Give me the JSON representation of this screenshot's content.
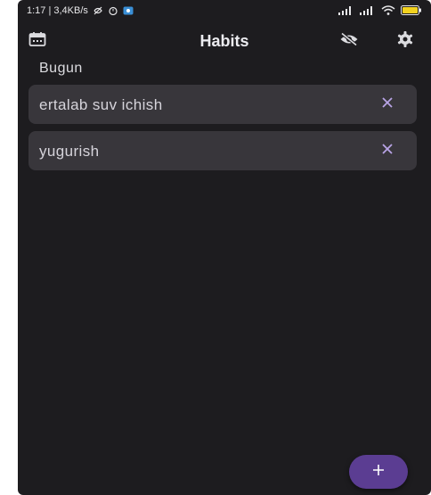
{
  "status_bar": {
    "time_speed": "1:17 | 3,4KB/s",
    "icons": [
      "hidden-sync-icon",
      "alarm-icon",
      "app-notification-icon"
    ],
    "right_icons": [
      "signal-icon",
      "signal-icon",
      "wifi-icon",
      "battery-icon"
    ]
  },
  "app_bar": {
    "title": "Habits",
    "left_icon": "calendar-icon",
    "right_icons": [
      "visibility-off-icon",
      "settings-icon"
    ]
  },
  "section": {
    "title": "Bugun"
  },
  "habits": [
    {
      "label": "ertalab suv ichish",
      "action_icon": "close-icon"
    },
    {
      "label": "yugurish",
      "action_icon": "close-icon"
    }
  ],
  "fab": {
    "icon": "add-icon",
    "label": "+"
  },
  "colors": {
    "background": "#1d1c1f",
    "card": "#38363b",
    "accent": "#5b3d92",
    "remove_icon": "#b8a4e6",
    "text": "#d6d4db"
  }
}
